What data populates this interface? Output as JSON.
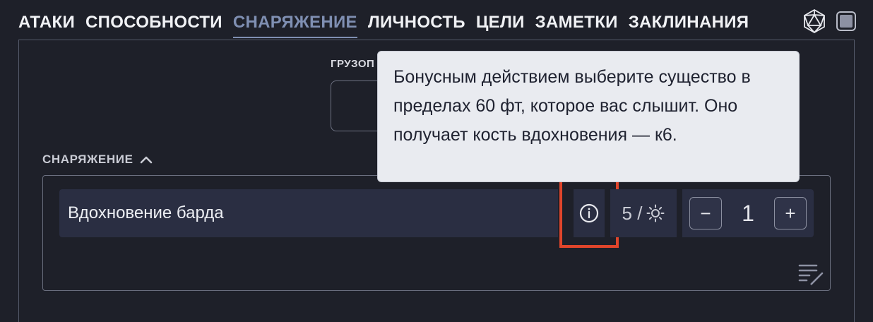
{
  "tabs": [
    {
      "label": "АТАКИ"
    },
    {
      "label": "СПОСОБНОСТИ"
    },
    {
      "label": "СНАРЯЖЕНИЕ",
      "active": true
    },
    {
      "label": "ЛИЧНОСТЬ"
    },
    {
      "label": "ЦЕЛИ"
    },
    {
      "label": "ЗАМЕТКИ"
    },
    {
      "label": "ЗАКЛИНАНИЯ"
    }
  ],
  "top_icons": [
    "d20-dice-icon",
    "square-toggle-icon"
  ],
  "load": {
    "label": "ГРУЗОП"
  },
  "section": {
    "title": "СНАРЯЖЕНИЕ",
    "toggle_icon": "chevron-up-icon"
  },
  "item": {
    "name": "Вдохновение барда",
    "info_icon": "info-icon",
    "uses_text": "5 /",
    "uses_icon": "sun-icon",
    "counter": {
      "minus": "−",
      "value": "1",
      "plus": "+"
    }
  },
  "tooltip": {
    "text": "Бонусным действием выберите существо в пределах 60 фт, которое вас слышит. Оно получает кость вдохновения — к6."
  },
  "colors": {
    "background": "#1e2029",
    "row": "#2a2e42",
    "active_tab": "#7f8fb2",
    "highlight": "#e0452b",
    "tooltip": "#e9ebf0"
  }
}
